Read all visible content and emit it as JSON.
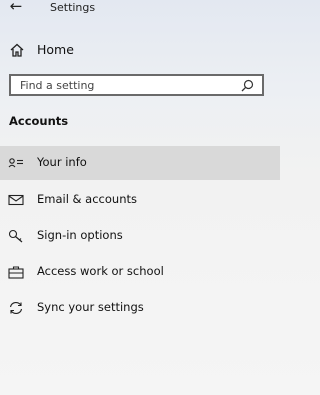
{
  "titlebar": {
    "back_glyph": "←",
    "title": "Settings"
  },
  "home": {
    "icon": "home-icon",
    "label": "Home"
  },
  "search": {
    "placeholder": "Find a setting",
    "icon": "search-icon"
  },
  "section": {
    "heading": "Accounts"
  },
  "nav": {
    "items": [
      {
        "label": "Your info",
        "icon": "person-card-icon",
        "selected": true
      },
      {
        "label": "Email & accounts",
        "icon": "envelope-icon",
        "selected": false
      },
      {
        "label": "Sign-in options",
        "icon": "key-icon",
        "selected": false
      },
      {
        "label": "Access work or school",
        "icon": "briefcase-icon",
        "selected": false
      },
      {
        "label": "Sync your settings",
        "icon": "sync-icon",
        "selected": false
      }
    ]
  },
  "colors": {
    "selected_background": "#d9d9d9",
    "search_border": "#6a6a6a"
  }
}
